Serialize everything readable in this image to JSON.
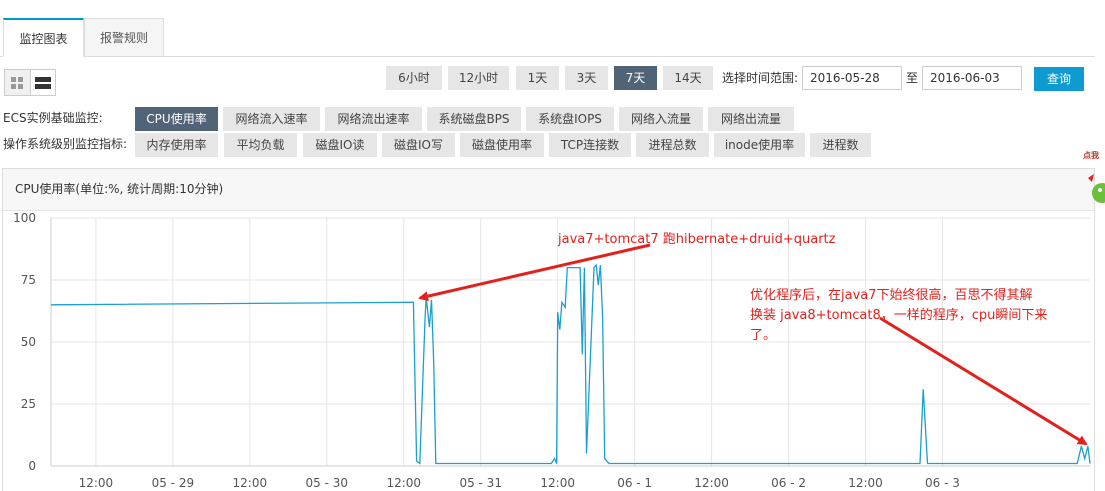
{
  "tabs": {
    "monitor": "监控图表",
    "alarm": "报警规则"
  },
  "ranges": [
    "6小时",
    "12小时",
    "1天",
    "3天",
    "7天",
    "14天"
  ],
  "active_range": "7天",
  "time_range": {
    "label": "选择时间范围:",
    "start": "2016-05-28",
    "sep": "至",
    "end": "2016-06-03",
    "query": "查询"
  },
  "ecs": {
    "label": "ECS实例基础监控:",
    "items": [
      "CPU使用率",
      "网络流入速率",
      "网络流出速率",
      "系统磁盘BPS",
      "系统盘IOPS",
      "网络入流量",
      "网络出流量"
    ],
    "active": "CPU使用率"
  },
  "os": {
    "label": "操作系统级别监控指标:",
    "items": [
      "内存使用率",
      "平均负载",
      "磁盘IO读",
      "磁盘IO写",
      "磁盘使用率",
      "TCP连接数",
      "进程总数",
      "inode使用率",
      "进程数"
    ]
  },
  "panel_title": "CPU使用率(单位:%, 统计周期:10分钟)",
  "annotations": {
    "a1": "java7+tomcat7 跑hibernate+druid+quartz",
    "a2_l1": "优化程序后，在java7下始终很高，百思不得其解",
    "a2_l2": "换装 java8+tomcat8，一样的程序，cpu瞬间下来",
    "a2_l3": "了。"
  },
  "side_widget_text": "点我",
  "colors": {
    "accent": "#0e9bd2",
    "active_btn": "#516376",
    "series": "#1a9fd0",
    "annotation": "#e2211c"
  },
  "chart_data": {
    "type": "line",
    "title": "CPU使用率(单位:%, 统计周期:10分钟)",
    "xlabel": "",
    "ylabel": "",
    "ylim": [
      0,
      100
    ],
    "yticks": [
      0,
      25,
      50,
      75,
      100
    ],
    "xlim": [
      "2016-05-28 05:00",
      "2016-06-03 23:00"
    ],
    "xtick_labels": [
      "12:00",
      "05 - 29",
      "12:00",
      "05 - 30",
      "12:00",
      "05 - 31",
      "12:00",
      "06 - 1",
      "12:00",
      "06 - 2",
      "12:00",
      "06 - 3"
    ],
    "xtick_times": [
      "2016-05-28 12:00",
      "2016-05-29 00:00",
      "2016-05-29 12:00",
      "2016-05-30 00:00",
      "2016-05-30 12:00",
      "2016-05-31 00:00",
      "2016-05-31 12:00",
      "2016-06-01 00:00",
      "2016-06-01 12:00",
      "2016-06-02 00:00",
      "2016-06-02 12:00",
      "2016-06-03 00:00"
    ],
    "grid": true,
    "series": [
      {
        "x": [
          "2016-05-28 05:00",
          "2016-05-30 13:00",
          "2016-05-30 13:30",
          "2016-05-30 14:00",
          "2016-05-30 14:30",
          "2016-05-30 15:20",
          "2016-05-30 15:30",
          "2016-05-30 16:00",
          "2016-05-30 16:20",
          "2016-05-30 16:40",
          "2016-05-30 17:00",
          "2016-05-30 17:30",
          "2016-05-30 18:30",
          "2016-05-31 11:00",
          "2016-05-31 11:30",
          "2016-05-31 11:50",
          "2016-05-31 12:00",
          "2016-05-31 12:20",
          "2016-05-31 12:40",
          "2016-05-31 13:10",
          "2016-05-31 13:30",
          "2016-05-31 15:30",
          "2016-05-31 15:50",
          "2016-05-31 16:10",
          "2016-05-31 16:30",
          "2016-05-31 17:40",
          "2016-05-31 18:00",
          "2016-05-31 18:20",
          "2016-05-31 18:40",
          "2016-05-31 19:00",
          "2016-05-31 19:20",
          "2016-05-31 20:00",
          "2016-05-31 21:00",
          "2016-06-02 20:30",
          "2016-06-02 21:00",
          "2016-06-02 21:40",
          "2016-06-02 22:30",
          "2016-06-03 21:00",
          "2016-06-03 21:40",
          "2016-06-03 22:10",
          "2016-06-03 22:40",
          "2016-06-03 23:00"
        ],
        "values": [
          65,
          66,
          66,
          2,
          1,
          60,
          68,
          56,
          67,
          42,
          1,
          1,
          1,
          1,
          3,
          1,
          62,
          55,
          66,
          64,
          80,
          80,
          45,
          80,
          5,
          80,
          81,
          73,
          81,
          60,
          3,
          1,
          1,
          1,
          31,
          1,
          1,
          1,
          8,
          3,
          8,
          1
        ]
      }
    ]
  }
}
